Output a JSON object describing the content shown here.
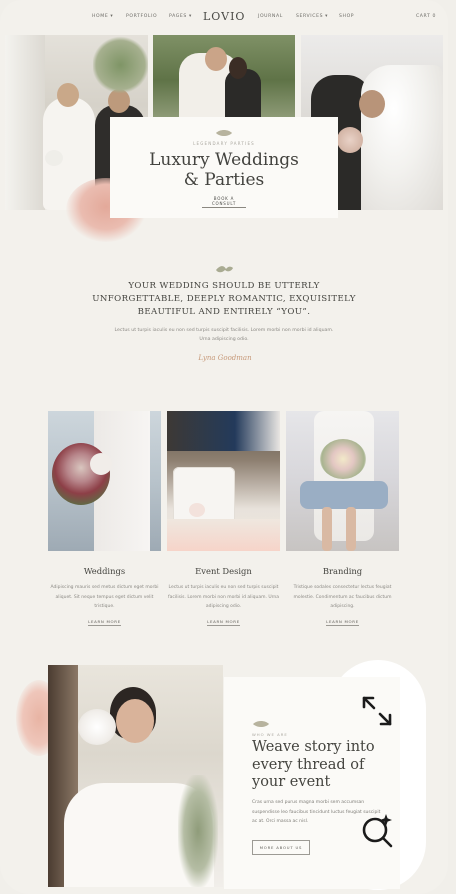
{
  "nav": {
    "items_left": [
      "HOME ▾",
      "PORTFOLIO",
      "PAGES ▾"
    ],
    "logo": "LOVIO",
    "items_right": [
      "JOURNAL",
      "SERVICES ▾",
      "SHOP"
    ],
    "cart": "CART 0"
  },
  "hero": {
    "eyebrow": "LEGENDARY PARTIES",
    "title_line1": "Luxury Weddings",
    "title_line2": "& Parties",
    "button": "BOOK A CONSULT"
  },
  "intro": {
    "title": "YOUR WEDDING SHOULD BE UTTERLY UNFORGETTABLE, DEEPLY ROMANTIC, EXQUISITELY BEAUTIFUL AND ENTIRELY “YOU”.",
    "body": "Lectus ut turpis iaculis eu non sed turpis suscipit facilisis. Lorem morbi non morbi id aliquam. Urna adipiscing odio.",
    "signature": "Lyna Goodman"
  },
  "services": [
    {
      "title": "Weddings",
      "body": "Adipiscing mauris sed metus dictum eget morbi aliquet. Sit neque tempus eget dictum velit tristique.",
      "link": "LEARN MORE"
    },
    {
      "title": "Event Design",
      "body": "Lectus ut turpis iaculis eu non sed turpis suscipit facilisis. Lorem morbi non morbi id aliquam. Urna adipiscing odio.",
      "link": "LEARN MORE"
    },
    {
      "title": "Branding",
      "body": "Tristique sodales consectetur lectus feugiat molestie. Condimentum ac faucibus dictum adipiscing.",
      "link": "LEARN MORE"
    }
  ],
  "about": {
    "eyebrow": "WHO WE ARE",
    "title_line1": "Weave story into",
    "title_line2": "every thread of",
    "title_line3": "your event",
    "body": "Cras urna sed purus magna morbi sem accumsan suspendisse leo faucibus tincidunt luctus feugiat suscipit ac at. Orci massa ac nisl.",
    "button": "MORE ABOUT US"
  },
  "colors": {
    "background": "#f3f1ec",
    "card": "#fbfaf7",
    "accent": "#c79a7a",
    "text": "#44443f"
  },
  "icons": [
    "leaf-mark-icon",
    "expand-icon",
    "search-sparkle-icon"
  ]
}
